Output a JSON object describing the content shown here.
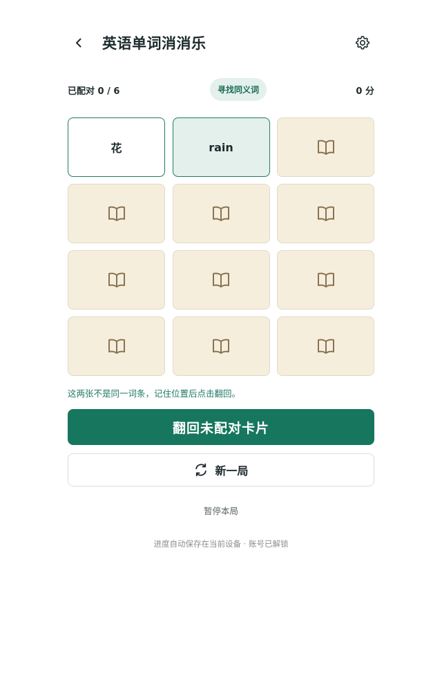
{
  "header": {
    "title": "英语单词消消乐",
    "back_icon": "chevron-left-icon",
    "settings_icon": "gear-icon"
  },
  "status": {
    "pairs_text": "已配对 0 / 6",
    "mode_label": "寻找同义词",
    "score_text": "0 分"
  },
  "cards": [
    {
      "state": "open",
      "text": "花"
    },
    {
      "state": "open-selected",
      "text": "rain"
    },
    {
      "state": "hidden",
      "icon": "book-icon"
    },
    {
      "state": "hidden",
      "icon": "book-icon"
    },
    {
      "state": "hidden",
      "icon": "book-icon"
    },
    {
      "state": "hidden",
      "icon": "book-icon"
    },
    {
      "state": "hidden",
      "icon": "book-icon"
    },
    {
      "state": "hidden",
      "icon": "book-icon"
    },
    {
      "state": "hidden",
      "icon": "book-icon"
    },
    {
      "state": "hidden",
      "icon": "book-icon"
    },
    {
      "state": "hidden",
      "icon": "book-icon"
    },
    {
      "state": "hidden",
      "icon": "book-icon"
    }
  ],
  "hint": "这两张不是同一词条，记住位置后点击翻回。",
  "actions": {
    "flip_back_label": "翻回未配对卡片",
    "new_game_label": "新一局",
    "new_game_icon": "refresh-icon",
    "pause_label": "暂停本局"
  },
  "footer": "进度自动保存在当前设备 · 账号已解锁",
  "colors": {
    "accent": "#16765e",
    "card_back": "#f6eedd",
    "selected_card": "#e3f0ec",
    "book_icon": "#8a7350"
  }
}
